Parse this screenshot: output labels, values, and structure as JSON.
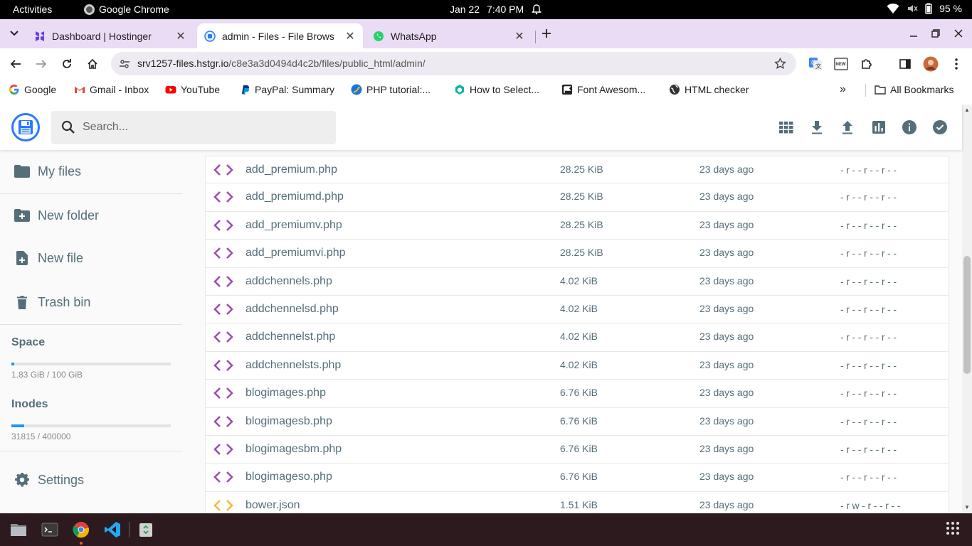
{
  "topbar": {
    "activities": "Activities",
    "app_name": "Google Chrome",
    "date": "Jan 22",
    "time": "7:40 PM",
    "battery": "95 %"
  },
  "tabs": [
    {
      "title": "Dashboard | Hostinger",
      "icon": "hostinger-icon"
    },
    {
      "title": "admin - Files - File Brows",
      "icon": "filebrowser-icon"
    },
    {
      "title": "WhatsApp",
      "icon": "whatsapp-icon"
    }
  ],
  "address": {
    "host": "srv1257-files.hstgr.io",
    "path": "/c8e3a3d0494d4c2b/files/public_html/admin/"
  },
  "bookmarks": [
    {
      "label": "Google",
      "icon": "google-icon"
    },
    {
      "label": "Gmail - Inbox",
      "icon": "gmail-icon"
    },
    {
      "label": "YouTube",
      "icon": "youtube-icon"
    },
    {
      "label": "PayPal: Summary",
      "icon": "paypal-icon"
    },
    {
      "label": "PHP tutorial:...",
      "icon": "php-icon"
    },
    {
      "label": "How to Select...",
      "icon": "hexagon-icon"
    },
    {
      "label": "Font Awesom...",
      "icon": "fontawesome-icon"
    },
    {
      "label": "HTML checker",
      "icon": "globe-icon"
    }
  ],
  "all_bookmarks": "All Bookmarks",
  "search": {
    "placeholder": "Search..."
  },
  "sidebar": {
    "items": [
      "My files",
      "New folder",
      "New file",
      "Trash bin"
    ],
    "space_label": "Space",
    "space_text": "1.83 GiB / 100 GiB",
    "space_fraction": 0.0183,
    "inodes_label": "Inodes",
    "inodes_text": "31815 / 400000",
    "inodes_fraction": 0.0795,
    "settings": "Settings"
  },
  "files": [
    {
      "name": "add_premium.php",
      "size": "28.25 KiB",
      "modified": "23 days ago",
      "perm": "-r--r--r--",
      "type": "code"
    },
    {
      "name": "add_premiumd.php",
      "size": "28.25 KiB",
      "modified": "23 days ago",
      "perm": "-r--r--r--",
      "type": "code"
    },
    {
      "name": "add_premiumv.php",
      "size": "28.25 KiB",
      "modified": "23 days ago",
      "perm": "-r--r--r--",
      "type": "code"
    },
    {
      "name": "add_premiumvi.php",
      "size": "28.25 KiB",
      "modified": "23 days ago",
      "perm": "-r--r--r--",
      "type": "code"
    },
    {
      "name": "addchennels.php",
      "size": "4.02 KiB",
      "modified": "23 days ago",
      "perm": "-r--r--r--",
      "type": "code"
    },
    {
      "name": "addchennelsd.php",
      "size": "4.02 KiB",
      "modified": "23 days ago",
      "perm": "-r--r--r--",
      "type": "code"
    },
    {
      "name": "addchennelst.php",
      "size": "4.02 KiB",
      "modified": "23 days ago",
      "perm": "-r--r--r--",
      "type": "code"
    },
    {
      "name": "addchennelsts.php",
      "size": "4.02 KiB",
      "modified": "23 days ago",
      "perm": "-r--r--r--",
      "type": "code"
    },
    {
      "name": "blogimages.php",
      "size": "6.76 KiB",
      "modified": "23 days ago",
      "perm": "-r--r--r--",
      "type": "code"
    },
    {
      "name": "blogimagesb.php",
      "size": "6.76 KiB",
      "modified": "23 days ago",
      "perm": "-r--r--r--",
      "type": "code"
    },
    {
      "name": "blogimagesbm.php",
      "size": "6.76 KiB",
      "modified": "23 days ago",
      "perm": "-r--r--r--",
      "type": "code"
    },
    {
      "name": "blogimageso.php",
      "size": "6.76 KiB",
      "modified": "23 days ago",
      "perm": "-r--r--r--",
      "type": "code"
    },
    {
      "name": "bower.json",
      "size": "1.51 KiB",
      "modified": "23 days ago",
      "perm": "-rw-r--r--",
      "type": "json"
    }
  ],
  "colors": {
    "code_icon": "#9c4fb0",
    "json_icon": "#f6b93b",
    "accent": "#2196f3",
    "tabstrip": "#e9dcf4"
  }
}
